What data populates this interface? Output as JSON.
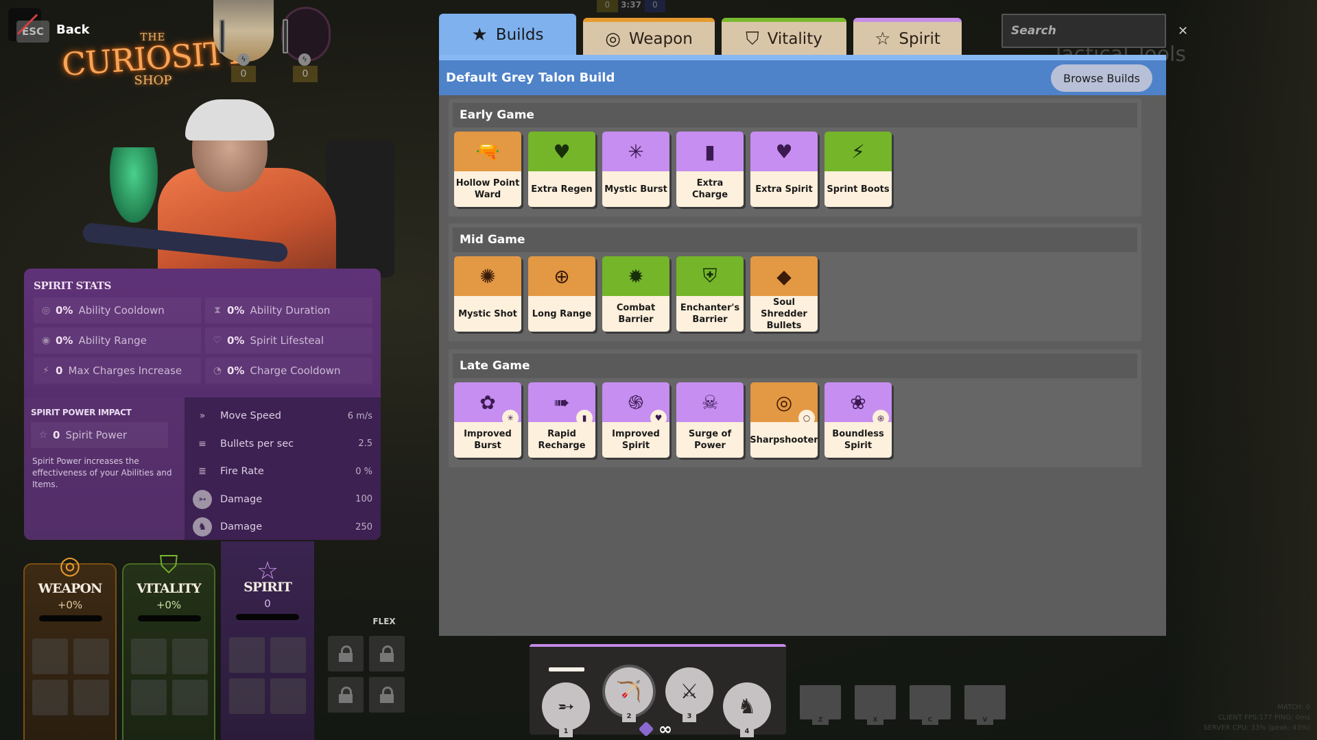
{
  "top_left": {
    "esc_key": "ESC",
    "back_label": "Back"
  },
  "logo": {
    "the": "THE",
    "main": "CURIOSITY",
    "shop": "SHOP"
  },
  "portraits": [
    {
      "count": "0"
    },
    {
      "count": "0"
    }
  ],
  "hud": {
    "left_souls": "0",
    "timer": "3:37",
    "right_souls": "0"
  },
  "tabs": [
    {
      "label": "Builds",
      "icon": "★",
      "accent": "#7fb1ef"
    },
    {
      "label": "Weapon",
      "icon": "◎",
      "accent": "#e69a2e"
    },
    {
      "label": "Vitality",
      "icon": "⛉",
      "accent": "#7ab92f"
    },
    {
      "label": "Spirit",
      "icon": "☆",
      "accent": "#c78ee8"
    }
  ],
  "search": {
    "placeholder": "Search",
    "value": "",
    "clear_icon": "✕"
  },
  "ghost_title": "Tactical Tools",
  "build": {
    "title": "Default Grey Talon Build",
    "browse_label": "Browse Builds"
  },
  "sections": [
    {
      "title": "Early Game",
      "items": [
        {
          "name": "Hollow Point Ward",
          "category": "weapon",
          "icon": "🔫"
        },
        {
          "name": "Extra Regen",
          "category": "vitality",
          "icon": "♥"
        },
        {
          "name": "Mystic Burst",
          "category": "spirit",
          "icon": "✳"
        },
        {
          "name": "Extra Charge",
          "category": "spirit",
          "icon": "▮"
        },
        {
          "name": "Extra Spirit",
          "category": "spirit",
          "icon": "♥"
        },
        {
          "name": "Sprint Boots",
          "category": "vitality",
          "icon": "⚡"
        }
      ]
    },
    {
      "title": "Mid Game",
      "items": [
        {
          "name": "Mystic Shot",
          "category": "weapon",
          "icon": "✺"
        },
        {
          "name": "Long Range",
          "category": "weapon",
          "icon": "⊕"
        },
        {
          "name": "Combat Barrier",
          "category": "vitality",
          "icon": "✹"
        },
        {
          "name": "Enchanter's Barrier",
          "category": "vitality",
          "icon": "⛨"
        },
        {
          "name": "Soul Shredder Bullets",
          "category": "weapon",
          "icon": "◆"
        }
      ]
    },
    {
      "title": "Late Game",
      "items": [
        {
          "name": "Improved Burst",
          "category": "spirit",
          "icon": "✿",
          "sub_icon": "✳"
        },
        {
          "name": "Rapid Recharge",
          "category": "spirit",
          "icon": "➠",
          "sub_icon": "▮"
        },
        {
          "name": "Improved Spirit",
          "category": "spirit",
          "icon": "֍",
          "sub_icon": "♥"
        },
        {
          "name": "Surge of Power",
          "category": "spirit",
          "icon": "☠",
          "sub_icon": ""
        },
        {
          "name": "Sharpshooter",
          "category": "weapon",
          "icon": "◎",
          "sub_icon": "○"
        },
        {
          "name": "Boundless Spirit",
          "category": "spirit",
          "icon": "❀",
          "sub_icon": "֍"
        }
      ]
    }
  ],
  "spirit_stats": {
    "title": "SPIRIT STATS",
    "stats": [
      {
        "icon": "cooldown",
        "glyph": "◎",
        "value": "0%",
        "label": "Ability Cooldown"
      },
      {
        "icon": "duration",
        "glyph": "⧗",
        "value": "0%",
        "label": "Ability Duration"
      },
      {
        "icon": "range",
        "glyph": "◉",
        "value": "0%",
        "label": "Ability Range"
      },
      {
        "icon": "lifesteal",
        "glyph": "♡",
        "value": "0%",
        "label": "Spirit Lifesteal"
      },
      {
        "icon": "charges",
        "glyph": "⚡",
        "value": "0",
        "label": "Max Charges Increase"
      },
      {
        "icon": "charge-cooldown",
        "glyph": "◔",
        "value": "0%",
        "label": "Charge Cooldown"
      }
    ],
    "impact_title": "SPIRIT POWER IMPACT",
    "spirit_power_value": "0",
    "spirit_power_label": "Spirit Power",
    "description": "Spirit Power increases the effectiveness of your Abilities and Items.",
    "impact_rows": [
      {
        "icon": "move-speed",
        "glyph": "»",
        "label": "Move Speed",
        "value": "6 m/s"
      },
      {
        "icon": "bullets-per-sec",
        "glyph": "≡",
        "label": "Bullets per sec",
        "value": "2.5"
      },
      {
        "icon": "fire-rate",
        "glyph": "≣",
        "label": "Fire Rate",
        "value": "0 %"
      },
      {
        "icon": "ability-1-damage",
        "glyph": "➳",
        "label": "Damage",
        "value": "100"
      },
      {
        "icon": "ability-4-damage",
        "glyph": "♞",
        "label": "Damage",
        "value": "250"
      }
    ]
  },
  "categories": [
    {
      "name": "WEAPON",
      "bonus": "+0%",
      "color": "#e69a2e",
      "progress": 0
    },
    {
      "name": "VITALITY",
      "bonus": "+0%",
      "color": "#7ab92f",
      "progress": 0
    },
    {
      "name": "SPIRIT",
      "bonus": "0",
      "color": "#c78ee8",
      "progress": 0
    }
  ],
  "flex_label": "FLEX",
  "abilities": [
    {
      "key": "1",
      "glyph": "➵"
    },
    {
      "key": "2",
      "glyph": "🏹"
    },
    {
      "key": "3",
      "glyph": "⚔"
    },
    {
      "key": "4",
      "glyph": "♞"
    }
  ],
  "ability_misc": {
    "infinity": "∞"
  },
  "item_hotkeys": [
    "Z",
    "X",
    "C",
    "V"
  ],
  "debug": {
    "line1": "MATCH: 0",
    "line2": "CLIENT FPS:177   PING: 0ms",
    "line3": "SERVER CPU: 33% (peak: 43%)"
  }
}
